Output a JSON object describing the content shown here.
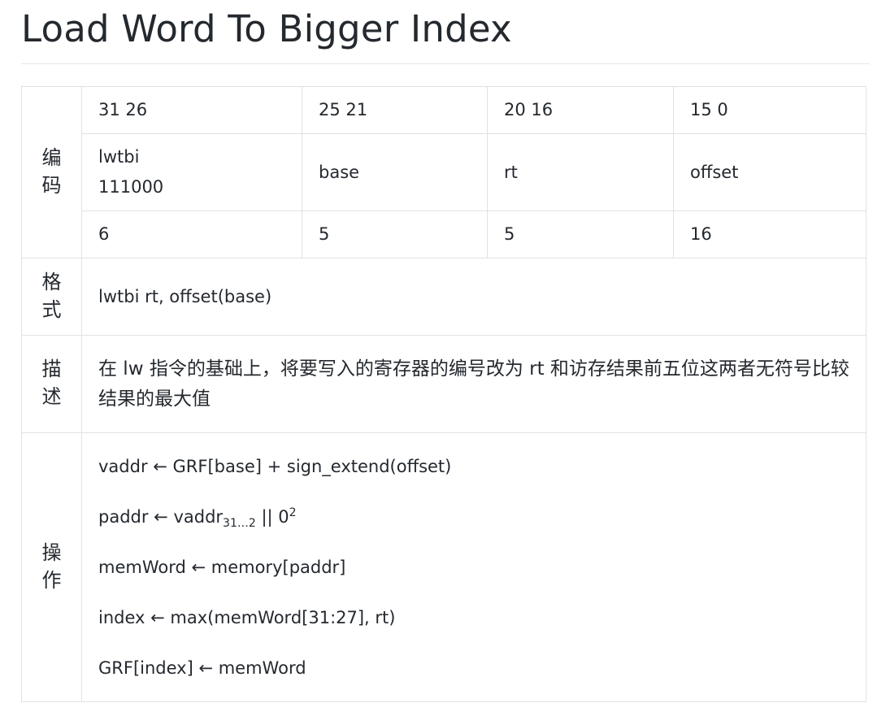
{
  "page_title": "Load Word To Bigger Index",
  "table": {
    "encoding_label": "编码",
    "bit_ranges": [
      "31 26",
      "25 21",
      "20 16",
      "15 0"
    ],
    "fields": [
      {
        "name": "lwtbi",
        "value": "111000"
      },
      {
        "name": "base"
      },
      {
        "name": "rt"
      },
      {
        "name": "offset"
      }
    ],
    "widths": [
      "6",
      "5",
      "5",
      "16"
    ],
    "format_label": "格式",
    "format_text": "lwtbi rt, offset(base)",
    "description_label": "描述",
    "description_text": "在 lw 指令的基础上，将要写入的寄存器的编号改为 rt 和访存结果前五位这两者无符号比较结果的最大值",
    "operation_label": "操作",
    "operations": {
      "line1": "vaddr ← GRF[base] + sign_extend(offset)",
      "line2_prefix": "paddr ← vaddr",
      "line2_sub": "31…2",
      "line2_mid": " || 0",
      "line2_sup": "2",
      "line3": "memWord ← memory[paddr]",
      "line4": "index ← max(memWord[31:27], rt)",
      "line5": "GRF[index] ← memWord"
    }
  }
}
